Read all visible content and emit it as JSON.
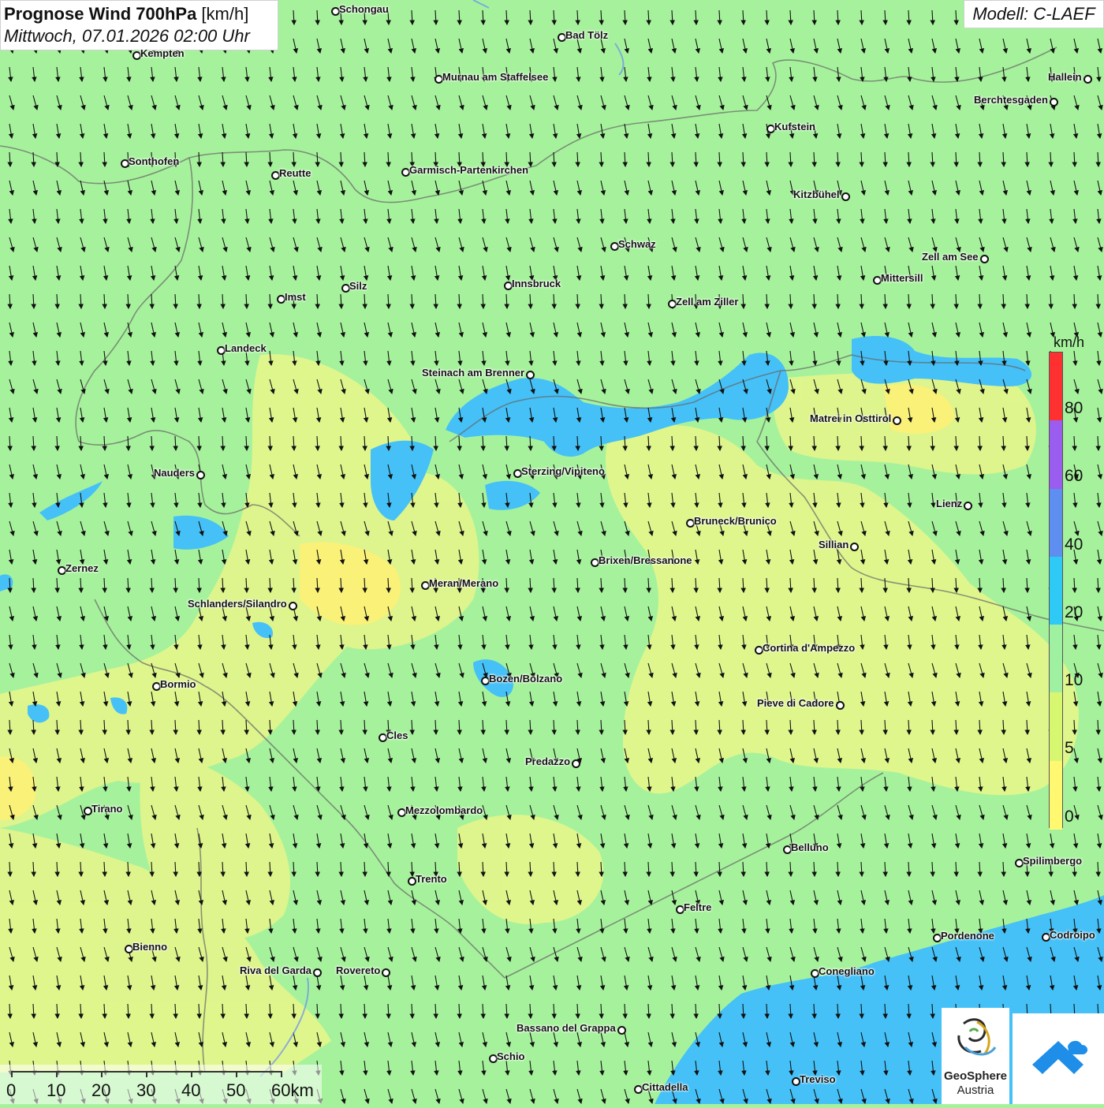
{
  "header": {
    "title_bold": "Prognose Wind 700hPa",
    "title_unit": " [km/h]",
    "subtitle": "Mittwoch, 07.01.2026 02:00 Uhr",
    "model": "Modell: C-LAEF"
  },
  "legend": {
    "unit": "km/h",
    "ticks": [
      "80",
      "60",
      "40",
      "20",
      "10",
      "5",
      "0"
    ],
    "colors": [
      "#ff3030",
      "#9b5cf0",
      "#5e8ef0",
      "#2ec9f5",
      "#9ff0a0",
      "#d8f770",
      "#fff870"
    ]
  },
  "scale_bar": {
    "labels": [
      "0",
      "10",
      "20",
      "30",
      "40",
      "50",
      "60km"
    ]
  },
  "logo": {
    "line1": "GeoSphere",
    "line2": "Austria"
  },
  "cities": [
    {
      "name": "Schongau"
    },
    {
      "name": "Bad Tölz"
    },
    {
      "name": "Kempten"
    },
    {
      "name": "Murnau am Staffelsee"
    },
    {
      "name": "Hallein"
    },
    {
      "name": "Berchtesgaden"
    },
    {
      "name": "Kufstein"
    },
    {
      "name": "Sonthofen"
    },
    {
      "name": "Reutte"
    },
    {
      "name": "Garmisch-Partenkirchen"
    },
    {
      "name": "Kitzbühel"
    },
    {
      "name": "Schwaz"
    },
    {
      "name": "Zell am See"
    },
    {
      "name": "Mittersill"
    },
    {
      "name": "Silz"
    },
    {
      "name": "Innsbruck"
    },
    {
      "name": "Imst"
    },
    {
      "name": "Zell am Ziller"
    },
    {
      "name": "Landeck"
    },
    {
      "name": "Steinach am Brenner"
    },
    {
      "name": "Matrei in Osttirol"
    },
    {
      "name": "Nauders"
    },
    {
      "name": "Sterzing/Vipiteno"
    },
    {
      "name": "Lienz"
    },
    {
      "name": "Bruneck/Brunico"
    },
    {
      "name": "Sillian"
    },
    {
      "name": "Brixen/Bressanone"
    },
    {
      "name": "Zernez"
    },
    {
      "name": "Meran/Merano"
    },
    {
      "name": "Schlanders/Silandro"
    },
    {
      "name": "Cortina d'Ampezzo"
    },
    {
      "name": "Bozen/Bolzano"
    },
    {
      "name": "Bormio"
    },
    {
      "name": "Pieve di Cadore"
    },
    {
      "name": "Cles"
    },
    {
      "name": "Predazzo"
    },
    {
      "name": "Tirano"
    },
    {
      "name": "Mezzolombardo"
    },
    {
      "name": "Belluno"
    },
    {
      "name": "Spilimbergo"
    },
    {
      "name": "Trento"
    },
    {
      "name": "Feltre"
    },
    {
      "name": "Pordenone"
    },
    {
      "name": "Codroipo"
    },
    {
      "name": "Bienno"
    },
    {
      "name": "Riva del Garda"
    },
    {
      "name": "Rovereto"
    },
    {
      "name": "Conegliano"
    },
    {
      "name": "Bassano del Grappa"
    },
    {
      "name": "Schio"
    },
    {
      "name": "Cittadella"
    },
    {
      "name": "Treviso"
    }
  ]
}
